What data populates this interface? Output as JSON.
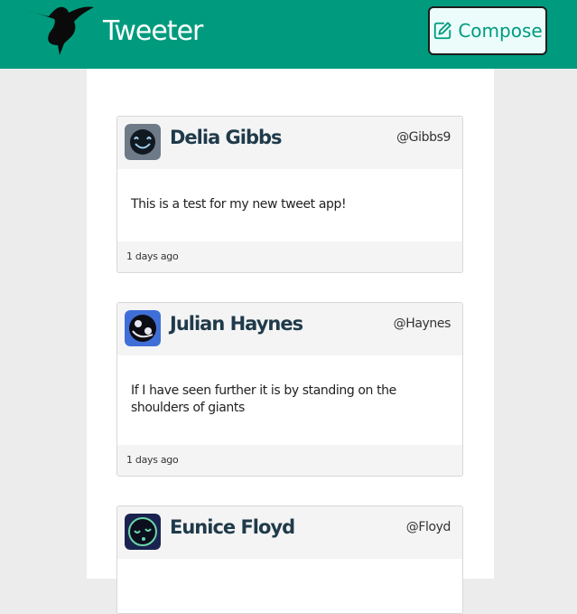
{
  "nav": {
    "brand": "Tweeter",
    "compose_label": "Compose",
    "accent_color": "#009b7e"
  },
  "tweets": [
    {
      "name": "Delia Gibbs",
      "handle": "@Gibbs9",
      "text": "This is a test for my new tweet app!",
      "age": "1 days ago",
      "avatar_icon": "happy-face-avatar-icon"
    },
    {
      "name": "Julian Haynes",
      "handle": "@Haynes",
      "text": "If I have seen further it is by standing on the shoulders of giants",
      "age": "1 days ago",
      "avatar_icon": "eye-face-avatar-icon"
    },
    {
      "name": "Eunice Floyd",
      "handle": "@Floyd",
      "text": "",
      "age": "",
      "avatar_icon": "sleepy-face-avatar-icon"
    }
  ]
}
